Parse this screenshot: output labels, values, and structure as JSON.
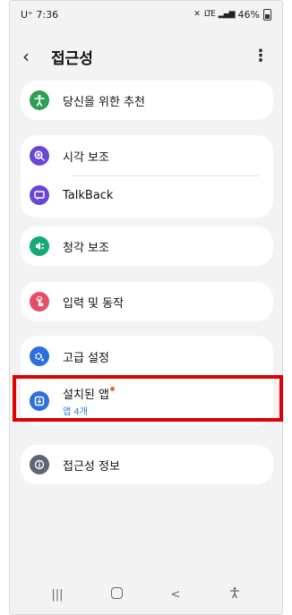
{
  "status_bar": {
    "time": "7:36",
    "carrier": "U⁺",
    "network": "LTE",
    "battery": "46%"
  },
  "header": {
    "title": "접근성"
  },
  "items": [
    {
      "label": "당신을 위한 추천",
      "icon": "accessibility-person-icon",
      "color": "#2e9e52"
    },
    {
      "label": "시각 보조",
      "icon": "zoom-icon",
      "color": "#6b45d6"
    },
    {
      "label": "TalkBack",
      "icon": "talkback-icon",
      "color": "#6b45d6"
    },
    {
      "label": "청각 보조",
      "icon": "hearing-icon",
      "color": "#16a876"
    },
    {
      "label": "입력 및 동작",
      "icon": "touch-icon",
      "color": "#e74d68"
    },
    {
      "label": "고급 설정",
      "icon": "advanced-settings-icon",
      "color": "#2c6fe0"
    },
    {
      "label": "설치된 앱",
      "sub": "앱 4개",
      "icon": "installed-apps-icon",
      "color": "#2c6fe0"
    },
    {
      "label": "접근성 정보",
      "icon": "info-icon",
      "color": "#5f6571"
    }
  ],
  "nav": {
    "recents": "|||",
    "home": "",
    "back": "<",
    "accessibility": "accessibility-shortcut-icon"
  }
}
